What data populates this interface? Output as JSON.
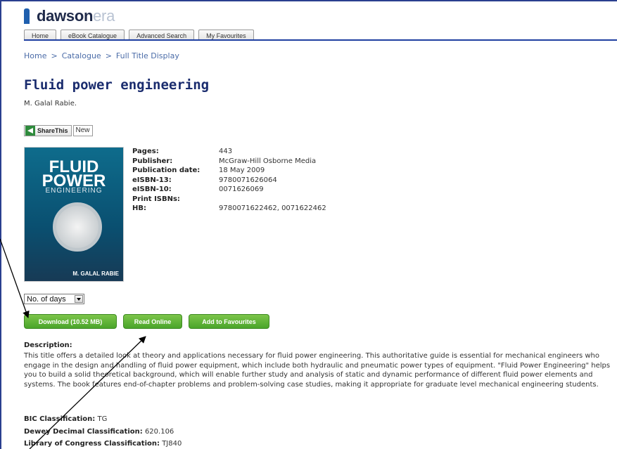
{
  "logo": {
    "brand": "dawson",
    "suffix": "era"
  },
  "tabs": [
    {
      "label": "Home"
    },
    {
      "label": "eBook Catalogue"
    },
    {
      "label": "Advanced Search"
    },
    {
      "label": "My Favourites"
    }
  ],
  "breadcrumb": {
    "items": [
      "Home",
      "Catalogue",
      "Full Title Display"
    ],
    "separator": ">"
  },
  "book": {
    "title": "Fluid power engineering",
    "author": "M. Galal Rabie.",
    "cover": {
      "line1": "FLUID",
      "line2": "POWER",
      "subtitle": "ENGINEERING",
      "author": "M. GALAL RABIE"
    },
    "meta": [
      {
        "label": "Pages:",
        "value": "443"
      },
      {
        "label": "Publisher:",
        "value": "McGraw-Hill Osborne Media"
      },
      {
        "label": "Publication date:",
        "value": "18 May 2009"
      },
      {
        "label": "eISBN-13:",
        "value": "9780071626064"
      },
      {
        "label": "eISBN-10:",
        "value": "0071626069"
      },
      {
        "label": "Print ISBNs:",
        "value": ""
      },
      {
        "label": "HB:",
        "value": "9780071622462, 0071622462"
      }
    ]
  },
  "share": {
    "label": "ShareThis",
    "new_label": "New"
  },
  "loan_select": {
    "value": "No. of days"
  },
  "buttons": {
    "download": "Download (10.52 MB)",
    "read_online": "Read Online",
    "add_favourites": "Add to Favourites"
  },
  "description": {
    "heading": "Description:",
    "text": "This title offers a detailed look at theory and applications necessary for fluid power engineering. This authoritative guide is essential for mechanical engineers who engage in the design and handling of fluid power equipment, which include both hydraulic and pneumatic power types of equipment. \"Fluid Power Engineering\" helps you to build a solid theoretical background, which will enable further study and analysis of static and dynamic performance of different fluid power elements and systems. The book features end-of-chapter problems and problem-solving case studies, making it appropriate for graduate level mechanical engineering students."
  },
  "classifications": [
    {
      "label": "BIC Classification:",
      "value": "TG"
    },
    {
      "label": "Dewey Decimal Classification:",
      "value": "620.106"
    },
    {
      "label": "Library of Congress Classification:",
      "value": "TJ840"
    }
  ],
  "colors": {
    "accent": "#1a2c6e",
    "button_green": "#4aa52a",
    "link": "#4b6ca8"
  }
}
